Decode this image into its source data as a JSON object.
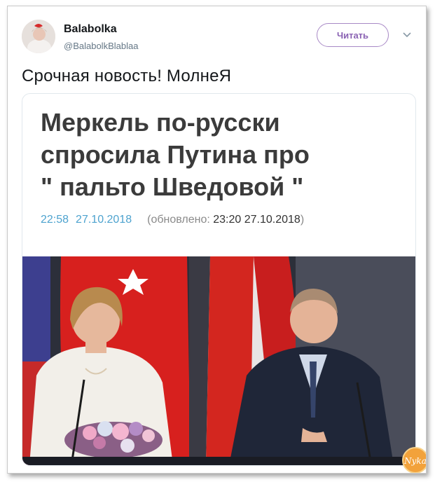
{
  "tweet": {
    "display_name": "Balabolka",
    "handle": "@BalabolkBlablaa",
    "follow_label": "Читать",
    "text": "Срочная новость! МолнеЯ",
    "menu_icon": "chevron-down-icon"
  },
  "card": {
    "headline_lines": [
      "Меркель по-русски",
      "спросила Путина про",
      "\" пальто  Шведовой \""
    ],
    "time": "22:58",
    "date": "27.10.2018",
    "updated_prefix": "(обновлено: ",
    "updated_value": "23:20 27.10.2018",
    "updated_suffix": ")"
  },
  "watermark": {
    "text": "Nyka"
  },
  "colors": {
    "accent_follow": "#8a62b3",
    "timestamp": "#4ea3cf",
    "flag_red": "#d7201e"
  }
}
